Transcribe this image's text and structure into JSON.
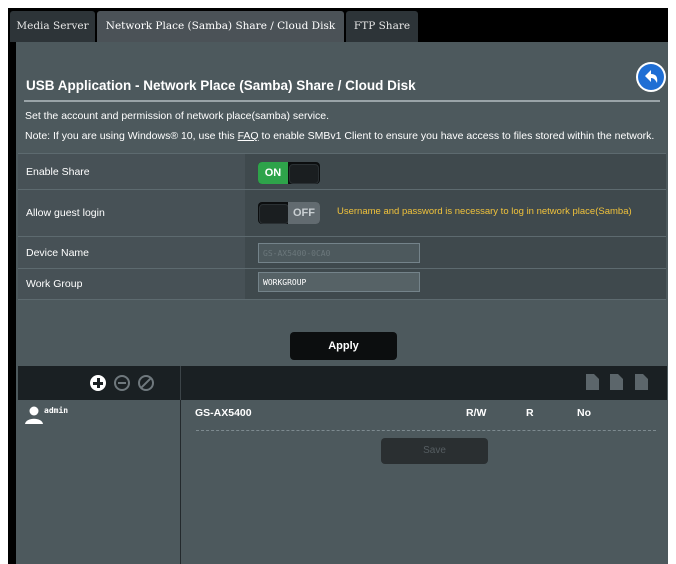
{
  "tabs": [
    {
      "label": "Media Server",
      "active": false
    },
    {
      "label": "Network Place (Samba) Share / Cloud Disk",
      "active": true
    },
    {
      "label": "FTP Share",
      "active": false
    }
  ],
  "page_title": "USB Application - Network Place (Samba) Share / Cloud Disk",
  "description": "Set the account and permission of network place(samba) service.",
  "note": {
    "before": "Note: If you are using Windows® 10, use this ",
    "link": "FAQ",
    "after": " to enable SMBv1 Client to ensure you have access to files stored within the network."
  },
  "form": {
    "enable_share": {
      "label": "Enable Share",
      "state": "ON"
    },
    "allow_guest": {
      "label": "Allow guest login",
      "state": "OFF",
      "warning": "Username and password is necessary to log in network place(Samba)"
    },
    "device_name": {
      "label": "Device Name",
      "value": "GS-AX5400-0CA0"
    },
    "work_group": {
      "label": "Work Group",
      "value": "WORKGROUP"
    }
  },
  "apply_label": "Apply",
  "users": [
    {
      "name": "admin"
    }
  ],
  "shares": [
    {
      "folder": "GS-AX5400",
      "rw": "R/W",
      "r": "R",
      "no": "No"
    }
  ],
  "save_label": "Save",
  "colors": {
    "accent": "#1f6ed4",
    "on_green": "#2ea34a",
    "warning": "#f0c23b",
    "panel_bg": "#4d595d"
  },
  "icons": [
    "back-arrow-icon",
    "add-user-icon",
    "delete-user-icon",
    "disable-user-icon",
    "add-folder-icon",
    "delete-folder-icon",
    "edit-folder-icon",
    "user-avatar-icon"
  ]
}
